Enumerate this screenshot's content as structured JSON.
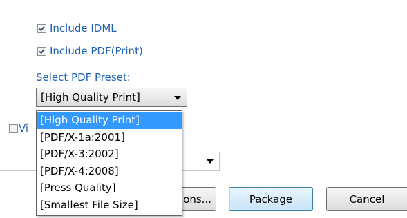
{
  "options": {
    "include_idml": {
      "label": "Include IDML",
      "checked": true
    },
    "include_pdf": {
      "label": "Include PDF(Print)",
      "checked": true
    },
    "preset_label": "Select PDF Preset:",
    "preset_value": "[High Quality Print]",
    "preset_options": [
      "[High Quality Print]",
      "[PDF/X-1a:2001]",
      "[PDF/X-3:2002]",
      "[PDF/X-4:2008]",
      "[Press Quality]",
      "[Smallest File Size]"
    ],
    "selected_option_index": 0,
    "view_report": {
      "label": "Vi",
      "checked": false
    }
  },
  "buttons": {
    "options_label": "ons...",
    "package_label": "Package",
    "cancel_label": "Cancel"
  },
  "colors": {
    "label_blue": "#1f63b5",
    "selection": "#3399ff"
  }
}
